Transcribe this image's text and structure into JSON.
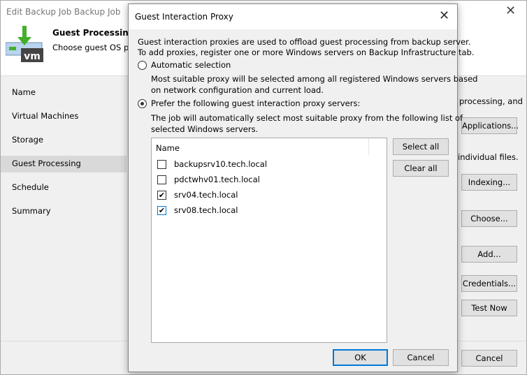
{
  "window": {
    "title": "Edit Backup Job Backup Job",
    "close": "✕"
  },
  "header": {
    "title": "Guest Processing",
    "subtitle": "Choose guest OS pro",
    "icon_text": "vm"
  },
  "nav": [
    {
      "label": "Name"
    },
    {
      "label": "Virtual Machines"
    },
    {
      "label": "Storage"
    },
    {
      "label": "Guest Processing",
      "selected": true
    },
    {
      "label": "Schedule"
    },
    {
      "label": "Summary"
    }
  ],
  "background": {
    "text1": "processing, and",
    "text2": "individual files.",
    "buttons": {
      "applications": "Applications...",
      "indexing": "Indexing...",
      "choose": "Choose...",
      "add": "Add...",
      "credentials": "Credentials...",
      "test_now": "Test Now",
      "cancel": "Cancel"
    }
  },
  "dialog": {
    "title": "Guest Interaction Proxy",
    "close": "✕",
    "intro1": "Guest interaction proxies are used to offload guest processing from backup server.",
    "intro2": "To add proxies, register one or more Windows servers on Backup Infrastructure tab.",
    "auto_label": "Automatic selection",
    "auto_selected": false,
    "auto_desc1": "Most suitable proxy will be selected among all registered Windows servers based",
    "auto_desc2": "on network configuration and current load.",
    "prefer_label": "Prefer the following guest interaction proxy servers:",
    "prefer_selected": true,
    "prefer_desc1": "The job will automatically select most suitable proxy from the following list of",
    "prefer_desc2": "selected Windows servers.",
    "column": "Name",
    "servers": [
      {
        "name": "backupsrv10.tech.local",
        "checked": false
      },
      {
        "name": "pdctwhv01.tech.local",
        "checked": false
      },
      {
        "name": "srv04.tech.local",
        "checked": true
      },
      {
        "name": "srv08.tech.local",
        "checked": true
      }
    ],
    "select_all": "Select all",
    "clear_all": "Clear all",
    "ok": "OK",
    "cancel": "Cancel"
  }
}
